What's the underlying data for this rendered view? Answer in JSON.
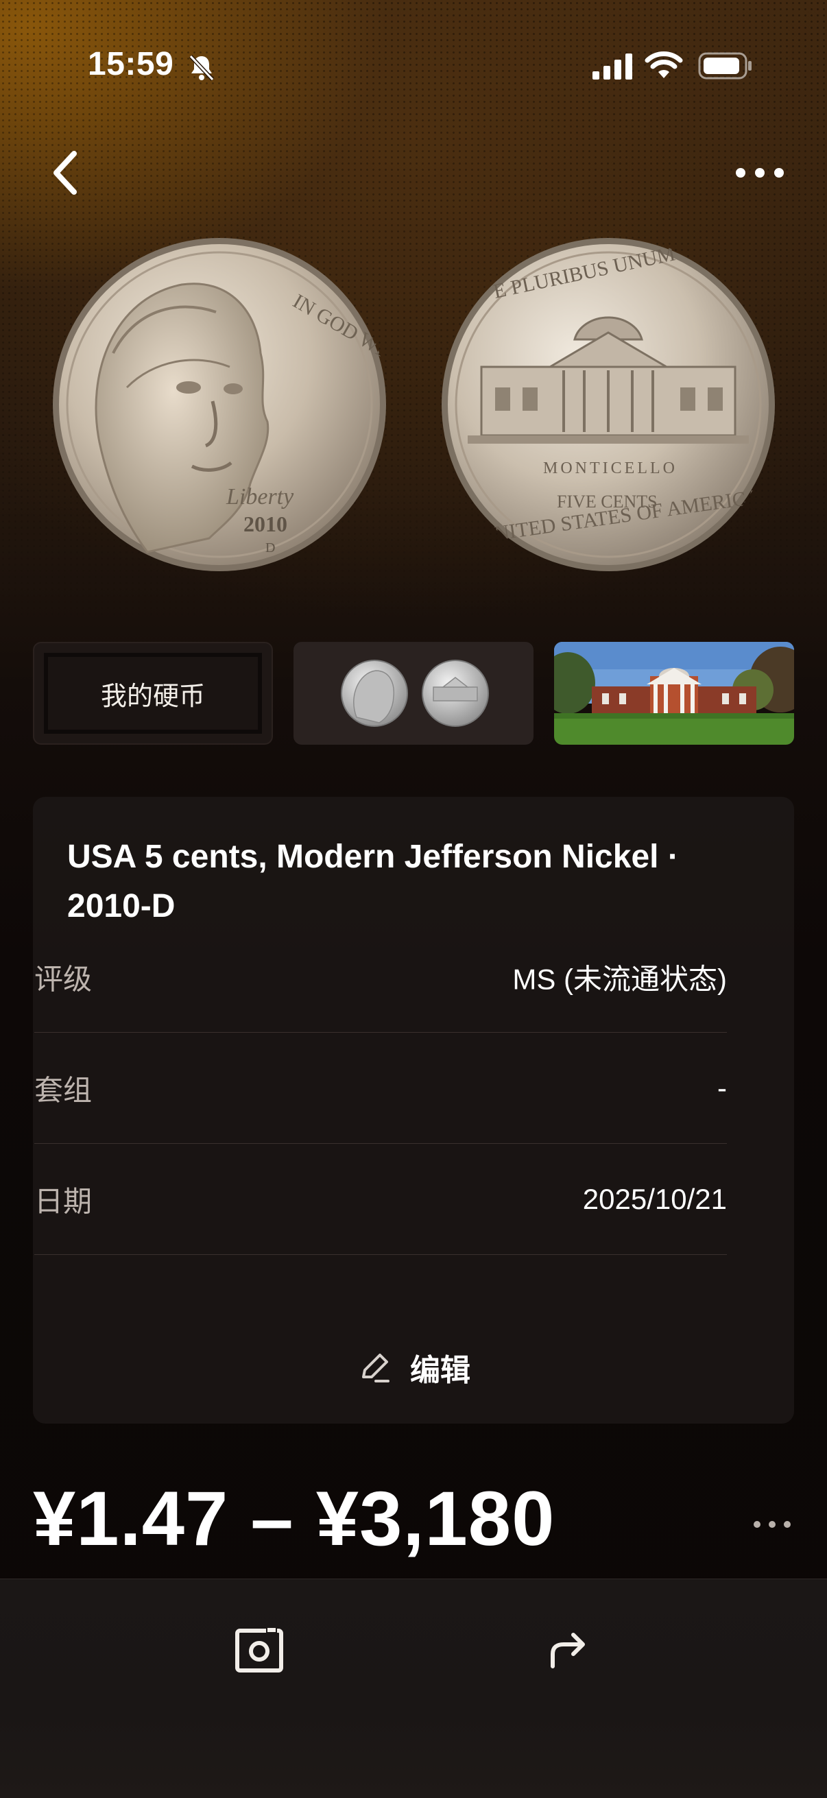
{
  "status_bar": {
    "time": "15:59"
  },
  "nav": {
    "back_icon": "chevron-left-icon",
    "more_icon": "more-horizontal-icon"
  },
  "images": {
    "obverse": "coin-obverse-jefferson",
    "reverse": "coin-reverse-monticello"
  },
  "thumbnails": [
    {
      "label": "我的硬币"
    },
    {
      "label": ""
    },
    {
      "label": ""
    }
  ],
  "details": {
    "title": "USA 5 cents, Modern Jefferson Nickel · 2010-D",
    "rows": [
      {
        "label": "评级",
        "value": "MS (未流通状态)"
      },
      {
        "label": "套组",
        "value": "-"
      },
      {
        "label": "日期",
        "value": "2025/10/21"
      }
    ],
    "edit_label": "编辑"
  },
  "price": {
    "range": "¥1.47 – ¥3,180"
  },
  "tab_bar": {
    "camera_icon": "camera-icon",
    "share_icon": "share-icon"
  },
  "colors": {
    "accent_gold": "#b57a12",
    "card_bg": "#1e1817",
    "text_secondary": "#bdb4ae"
  }
}
